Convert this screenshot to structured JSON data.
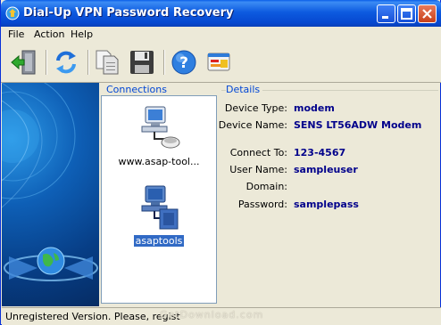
{
  "window": {
    "title": "Dial-Up VPN Password Recovery"
  },
  "menu": [
    {
      "label": "File"
    },
    {
      "label": "Action"
    },
    {
      "label": "Help"
    }
  ],
  "toolbar": {
    "icons": [
      "exit-door-icon",
      "refresh-icon",
      "copy-icon",
      "save-icon",
      "help-icon",
      "about-card-icon"
    ]
  },
  "connections": {
    "label": "Connections",
    "items": [
      {
        "name": "www.asap-tool...",
        "icon": "network-computer-icon",
        "selected": false
      },
      {
        "name": "asaptools",
        "icon": "network-computer-icon",
        "selected": true
      }
    ]
  },
  "details": {
    "label": "Details",
    "rows": [
      {
        "key": "Device Type:",
        "value": "modem"
      },
      {
        "key": "Device Name:",
        "value": "SENS LT56ADW Modem"
      },
      {
        "key": "Connect To:",
        "value": "123-4567"
      },
      {
        "key": "User Name:",
        "value": "sampleuser"
      },
      {
        "key": "Domain:",
        "value": ""
      },
      {
        "key": "Password:",
        "value": "samplepass"
      }
    ]
  },
  "status": {
    "text": "Unregistered Version. Please, regist"
  },
  "watermark": "GetDownload.com",
  "colors": {
    "titlebar": "#0A5FE8",
    "accent_label": "#0046D5",
    "value_text": "#00008B",
    "selection": "#316AC5"
  }
}
